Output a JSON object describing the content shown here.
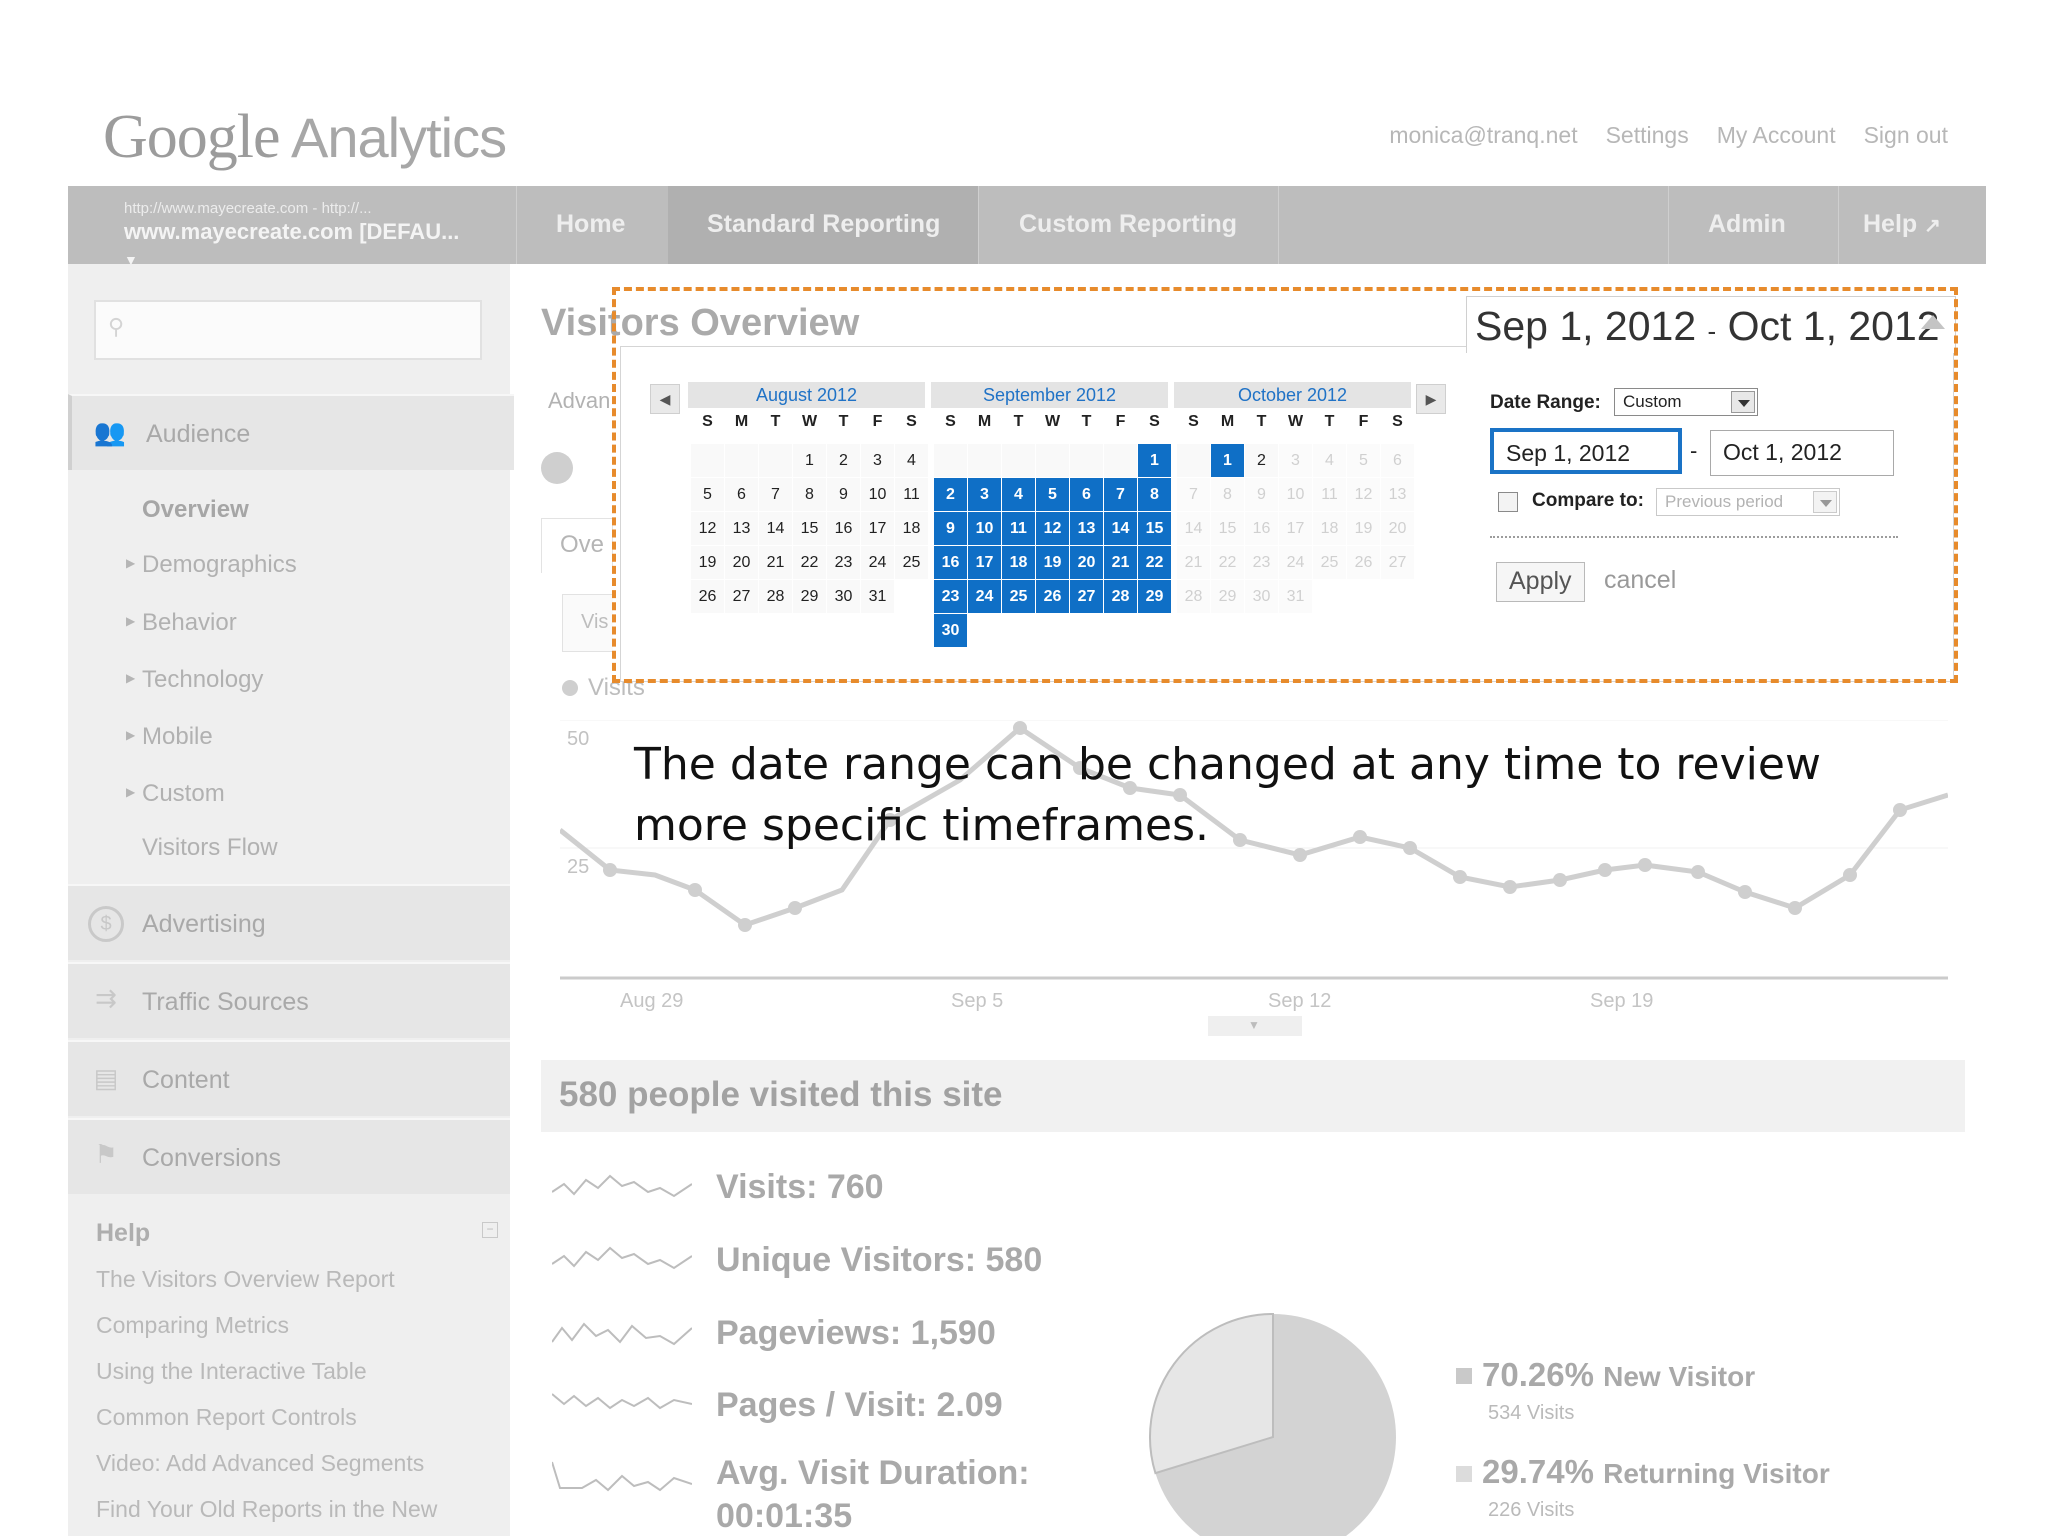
{
  "header": {
    "logo_google": "Google",
    "logo_product": "Analytics",
    "links": [
      "monica@tranq.net",
      "Settings",
      "My Account",
      "Sign out"
    ]
  },
  "nav": {
    "profile_url": "http://www.mayecreate.com - http://...",
    "profile_name": "www.mayecreate.com [DEFAU...",
    "items": [
      "Home",
      "Standard Reporting",
      "Custom Reporting"
    ],
    "right_items": [
      "Admin",
      "Help"
    ]
  },
  "sidebar": {
    "sections": [
      {
        "label": "Audience",
        "icon": "audience-icon"
      },
      {
        "label": "Advertising",
        "icon": "dollar-icon"
      },
      {
        "label": "Traffic Sources",
        "icon": "arrows-icon"
      },
      {
        "label": "Content",
        "icon": "content-icon"
      },
      {
        "label": "Conversions",
        "icon": "flag-icon"
      }
    ],
    "audience_items": [
      "Overview",
      "Demographics",
      "Behavior",
      "Technology",
      "Mobile",
      "Custom",
      "Visitors Flow"
    ],
    "help_title": "Help",
    "help_links": [
      "The Visitors Overview Report",
      "Comparing Metrics",
      "Using the Interactive Table",
      "Common Report Controls",
      "Video: Add Advanced Segments",
      "Find Your Old Reports in the New"
    ]
  },
  "main": {
    "title": "Visitors Overview",
    "partial_advanced": "Advan",
    "partial_overview": "Ove",
    "partial_visits_btn": "Vis",
    "legend_visits": "Visits",
    "y_tick_50": "50",
    "y_tick_25": "25",
    "x_ticks": [
      "Aug 29",
      "Sep 5",
      "Sep 12",
      "Sep 19"
    ],
    "summary_title": "580 people visited this site",
    "metrics": [
      {
        "label": "Visits: 760"
      },
      {
        "label": "Unique Visitors: 580"
      },
      {
        "label": "Pageviews: 1,590"
      },
      {
        "label": "Pages / Visit: 2.09"
      },
      {
        "label": "Avg. Visit Duration:"
      }
    ],
    "duration_value": "00:01:35",
    "pie": {
      "new_pct": "70.26%",
      "new_label": "New Visitor",
      "new_visits": "534 Visits",
      "ret_pct": "29.74%",
      "ret_label": "Returning Visitor",
      "ret_visits": "226 Visits",
      "new_fraction": 0.7026
    }
  },
  "date_picker": {
    "range_start": "Sep 1, 2012",
    "range_sep": "-",
    "range_end": "Oct 1, 2012",
    "months": [
      {
        "name": "August 2012",
        "start_dow": 3,
        "days": 31,
        "selected": [],
        "dimmed": []
      },
      {
        "name": "September 2012",
        "start_dow": 6,
        "days": 30,
        "selected": "all",
        "dimmed": []
      },
      {
        "name": "October 2012",
        "start_dow": 1,
        "days": 31,
        "selected": [
          1
        ],
        "dimmed": "after2"
      }
    ],
    "dow": [
      "S",
      "M",
      "T",
      "W",
      "T",
      "F",
      "S"
    ],
    "date_range_label": "Date Range:",
    "date_range_value": "Custom",
    "start_input": "Sep 1, 2012",
    "input_sep": "-",
    "end_input": "Oct 1, 2012",
    "compare_label": "Compare to:",
    "compare_value": "Previous period",
    "apply": "Apply",
    "cancel": "cancel"
  },
  "caption": "The date range can be changed at any time to review more specific timeframes.",
  "colors": {
    "highlight_border": "#e78b2c",
    "selected_day": "#0f6fc6",
    "month_header_text": "#1f72c6"
  }
}
